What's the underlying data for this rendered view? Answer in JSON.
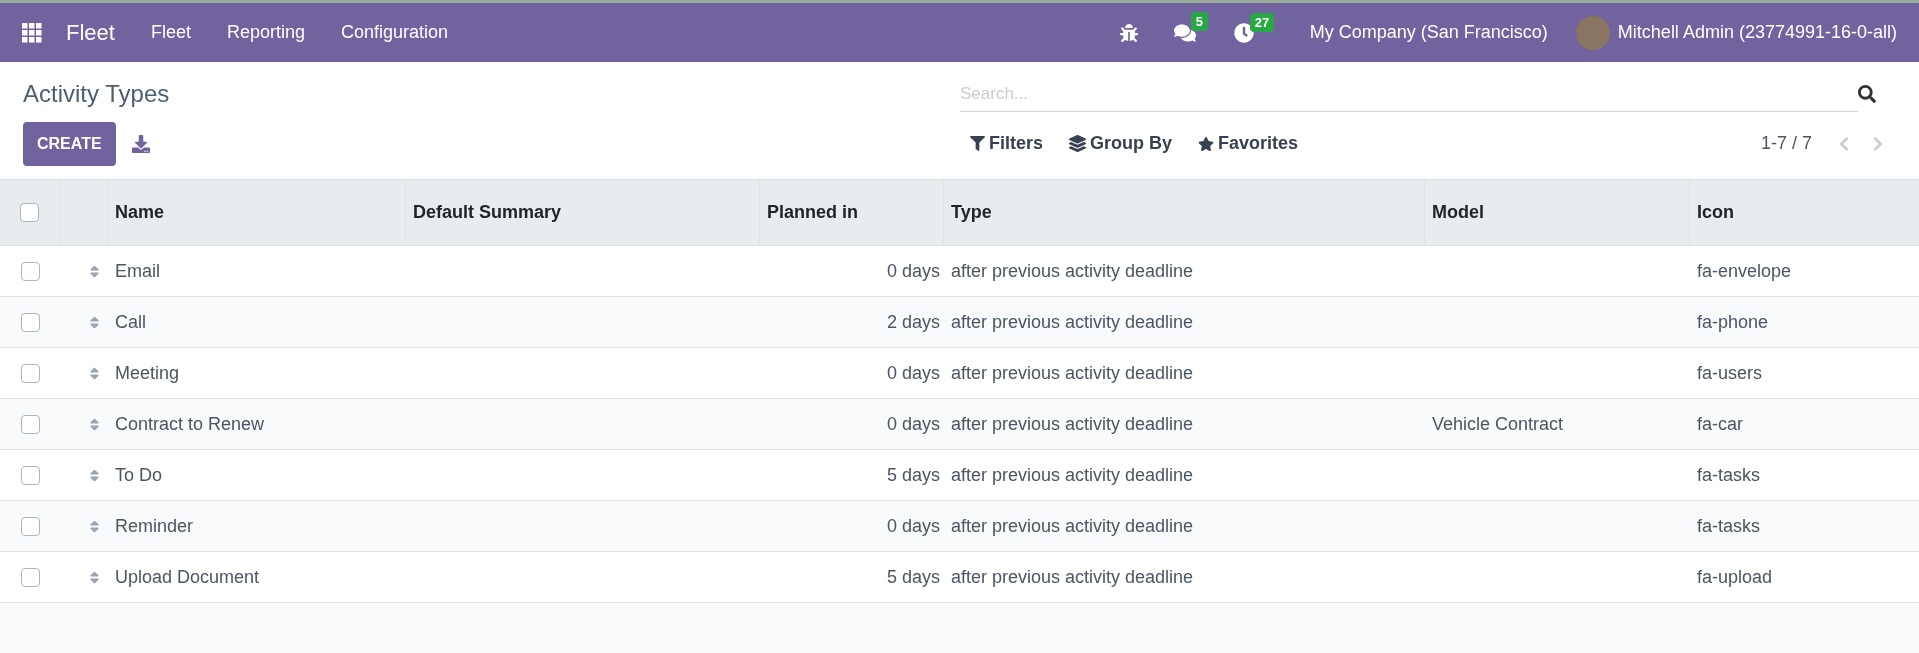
{
  "navbar": {
    "app": "Fleet",
    "menu": [
      "Fleet",
      "Reporting",
      "Configuration"
    ],
    "messages_count": "5",
    "activities_count": "27",
    "company": "My Company (San Francisco)",
    "user": "Mitchell Admin (23774991-16-0-all)"
  },
  "control_panel": {
    "title": "Activity Types",
    "create": "CREATE",
    "search": {
      "placeholder": "Search..."
    },
    "filters": "Filters",
    "group_by": "Group By",
    "favorites": "Favorites",
    "pager": "1-7 / 7"
  },
  "table": {
    "select_all": {
      "checked": false
    },
    "columns": [
      "Name",
      "Default Summary",
      "Planned in",
      "Type",
      "Model",
      "Icon"
    ],
    "rows": [
      {
        "checked": false,
        "name": "Email",
        "summary": "",
        "planned": "0 days",
        "type": "after previous activity deadline",
        "model": "",
        "icon": "fa-envelope"
      },
      {
        "checked": false,
        "name": "Call",
        "summary": "",
        "planned": "2 days",
        "type": "after previous activity deadline",
        "model": "",
        "icon": "fa-phone"
      },
      {
        "checked": false,
        "name": "Meeting",
        "summary": "",
        "planned": "0 days",
        "type": "after previous activity deadline",
        "model": "",
        "icon": "fa-users"
      },
      {
        "checked": false,
        "name": "Contract to Renew",
        "summary": "",
        "planned": "0 days",
        "type": "after previous activity deadline",
        "model": "Vehicle Contract",
        "icon": "fa-car"
      },
      {
        "checked": false,
        "name": "To Do",
        "summary": "",
        "planned": "5 days",
        "type": "after previous activity deadline",
        "model": "",
        "icon": "fa-tasks"
      },
      {
        "checked": false,
        "name": "Reminder",
        "summary": "",
        "planned": "0 days",
        "type": "after previous activity deadline",
        "model": "",
        "icon": "fa-tasks"
      },
      {
        "checked": false,
        "name": "Upload Document",
        "summary": "",
        "planned": "5 days",
        "type": "after previous activity deadline",
        "model": "",
        "icon": "fa-upload"
      }
    ]
  }
}
